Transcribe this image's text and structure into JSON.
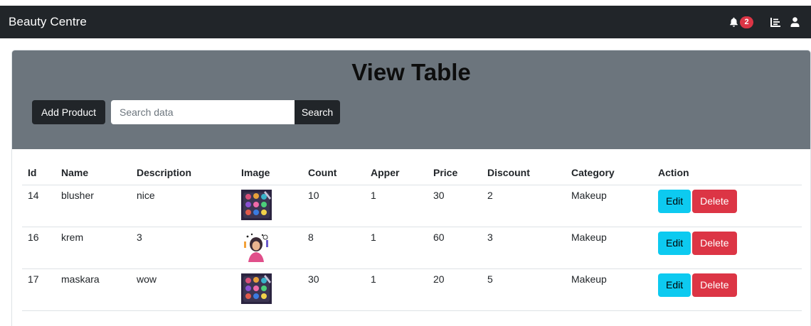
{
  "app": {
    "brand": "Beauty Centre",
    "notification_count": "2"
  },
  "nav": {
    "icons": [
      "bell-icon",
      "list-icon",
      "user-icon"
    ]
  },
  "page": {
    "title": "View Table"
  },
  "toolbar": {
    "add_label": "Add Product",
    "search_placeholder": "Search data",
    "search_value": "",
    "search_label": "Search"
  },
  "table": {
    "headers": [
      "Id",
      "Name",
      "Description",
      "Image",
      "Count",
      "Apper",
      "Price",
      "Discount",
      "Category",
      "Action"
    ],
    "rows": [
      {
        "id": "14",
        "name": "blusher",
        "description": "nice",
        "image": "makeup-palette",
        "count": "10",
        "apper": "1",
        "price": "30",
        "discount": "2",
        "category": "Makeup",
        "edit": "Edit",
        "delete": "Delete"
      },
      {
        "id": "16",
        "name": "krem",
        "description": "3",
        "image": "woman-cosmetics",
        "count": "8",
        "apper": "1",
        "price": "60",
        "discount": "3",
        "category": "Makeup",
        "edit": "Edit",
        "delete": "Delete"
      },
      {
        "id": "17",
        "name": "maskara",
        "description": "wow",
        "image": "makeup-palette",
        "count": "30",
        "apper": "1",
        "price": "20",
        "discount": "5",
        "category": "Makeup",
        "edit": "Edit",
        "delete": "Delete"
      }
    ]
  },
  "colors": {
    "navbar": "#212529",
    "header_bg": "#6c757d",
    "edit": "#0dcaf0",
    "delete": "#dc3545",
    "badge": "#dc3545"
  }
}
